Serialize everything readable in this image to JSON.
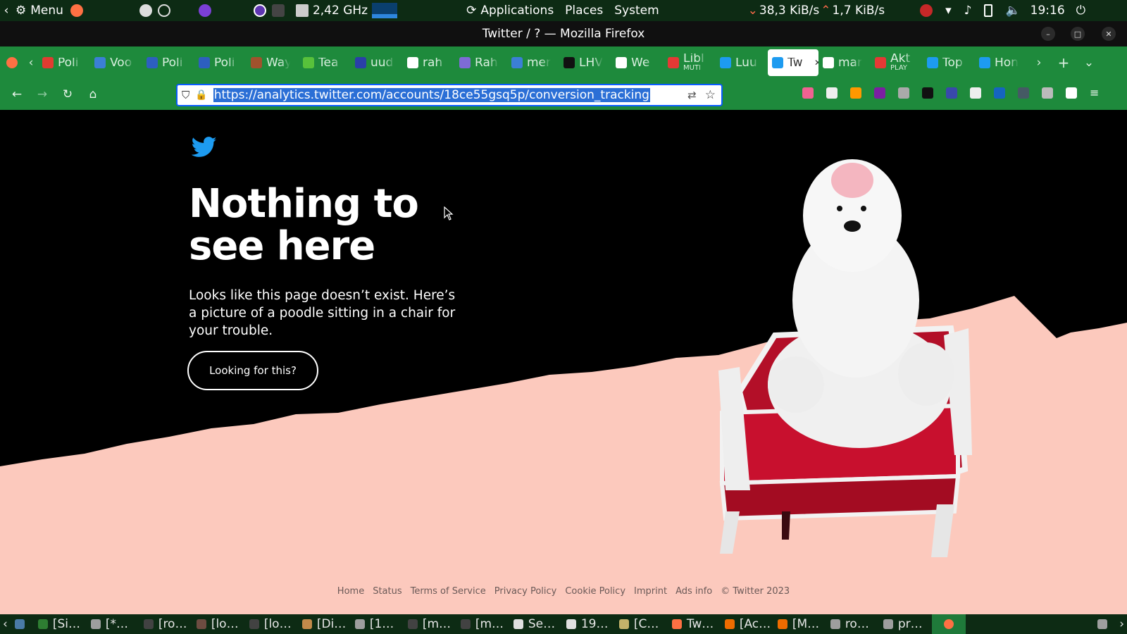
{
  "system_panel": {
    "menu_label": "Menu",
    "cpu_freq": "2,42 GHz",
    "menus": [
      "Applications",
      "Places",
      "System"
    ],
    "net_down": "38,3 KiB/s",
    "net_up": "1,7 KiB/s",
    "clock": "19:16"
  },
  "window": {
    "title": "Twitter / ? — Mozilla Firefox"
  },
  "tabs": [
    {
      "label": "Poli",
      "color": "#e03c31"
    },
    {
      "label": "Voo",
      "color": "#3b7fd6"
    },
    {
      "label": "Poli",
      "color": "#2d5fbf"
    },
    {
      "label": "Poli",
      "color": "#2d5fbf"
    },
    {
      "label": "Way",
      "color": "#a0522d"
    },
    {
      "label": "Tea",
      "color": "#58c13b"
    },
    {
      "label": "uud",
      "color": "#2a3fa8"
    },
    {
      "label": "rah",
      "color": "#ffffff"
    },
    {
      "label": "Rah",
      "color": "#7e6bd6"
    },
    {
      "label": "mer",
      "color": "#3b7fd6"
    },
    {
      "label": "LHV",
      "color": "#111111"
    },
    {
      "label": "We",
      "color": "#ffffff"
    },
    {
      "label": "Libl",
      "sub": "MUTI",
      "color": "#e53935"
    },
    {
      "label": "Luu",
      "color": "#1d9bf0"
    },
    {
      "label": "Tw",
      "color": "#1d9bf0",
      "active": true
    },
    {
      "label": "mar",
      "color": "#ffffff"
    },
    {
      "label": "Akt",
      "sub": "PLAY",
      "color": "#e53935"
    },
    {
      "label": "Top",
      "color": "#1d9bf0"
    },
    {
      "label": "Hon",
      "color": "#1d9bf0"
    }
  ],
  "nav": {
    "url": "https://analytics.twitter.com/accounts/18ce55gsq5p/conversion_tracking"
  },
  "page": {
    "headline": "Nothing to see here",
    "body": "Looks like this page doesn’t exist. Here’s a picture of a poodle sitting in a chair for your trouble.",
    "cta": "Looking for this?",
    "footer_links": [
      "Home",
      "Status",
      "Terms of Service",
      "Privacy Policy",
      "Cookie Policy",
      "Imprint",
      "Ads info",
      "© Twitter 2023"
    ]
  },
  "taskbar": [
    {
      "label": "[Si…",
      "color": "#2e7d32"
    },
    {
      "label": "[*…",
      "color": "#9e9e9e"
    },
    {
      "label": "[ro…",
      "color": "#424242"
    },
    {
      "label": "[lo…",
      "color": "#6d4c41"
    },
    {
      "label": "[lo…",
      "color": "#424242"
    },
    {
      "label": "[Di…",
      "color": "#c28a4a"
    },
    {
      "label": "[1…",
      "color": "#9e9e9e"
    },
    {
      "label": "[m…",
      "color": "#424242"
    },
    {
      "label": "[m…",
      "color": "#424242"
    },
    {
      "label": "Se…",
      "color": "#e0e0e0"
    },
    {
      "label": "19…",
      "color": "#e0e0e0"
    },
    {
      "label": "[C…",
      "color": "#c5b36a"
    },
    {
      "label": "Tw…",
      "color": "#ff7043"
    },
    {
      "label": "[Ac…",
      "color": "#ef6c00"
    },
    {
      "label": "[M…",
      "color": "#ef6c00"
    },
    {
      "label": "ro…",
      "color": "#9e9e9e"
    },
    {
      "label": "pr…",
      "color": "#9e9e9e"
    }
  ],
  "colors": {
    "brand": "#1d9bf0",
    "page_bg": "#000000",
    "ground": "#fcc9bd",
    "chair": "#c8102e",
    "panel_green": "#0d2b14",
    "firefox_green": "#1e8a3c"
  }
}
